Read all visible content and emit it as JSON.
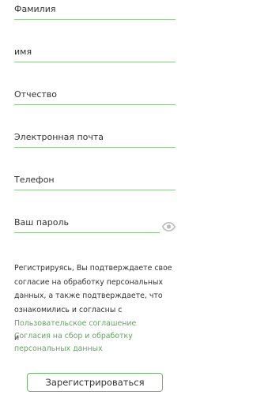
{
  "form": {
    "fields": [
      {
        "name": "surname",
        "placeholder": "Фамилия",
        "value": ""
      },
      {
        "name": "first_name",
        "placeholder": "имя",
        "value": ""
      },
      {
        "name": "patronymic",
        "placeholder": "Отчество",
        "value": ""
      },
      {
        "name": "email",
        "placeholder": "Электронная почта",
        "value": ""
      },
      {
        "name": "phone",
        "placeholder": "Телефон",
        "value": ""
      },
      {
        "name": "password",
        "placeholder": "Ваш пароль",
        "value": ""
      }
    ],
    "password_toggle_icon": "eye-icon",
    "consent_text": "Регистрируясь, Вы подтверждаете свое согласие на обработку персональных данных, а также подтверждаете, что ознакомились и согласны с",
    "user_agreement_link": "Пользовательское соглашение",
    "and_text": "и",
    "data_processing_link": "Согласия на сбор и обработку персональных данных",
    "submit_label": "Зарегистрироваться"
  },
  "colors": {
    "accent": "#5ba85b",
    "underline": "#8fca8f",
    "text": "#333333",
    "icon": "#bbbbbb"
  }
}
